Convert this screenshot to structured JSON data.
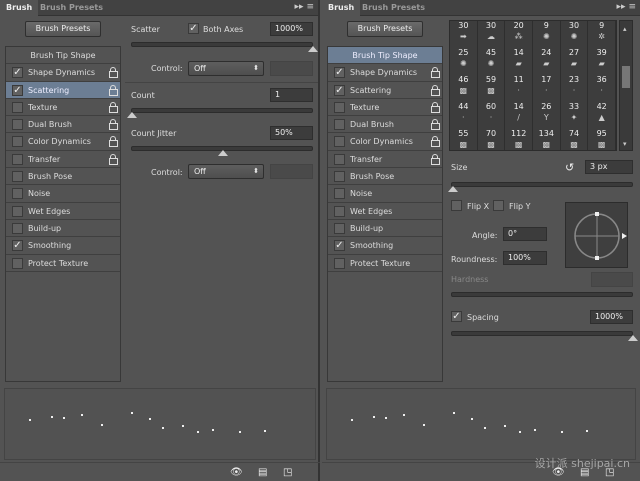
{
  "tabs": {
    "brush": "Brush",
    "presets": "Brush Presets",
    "collapse_icon": "▸▸",
    "menu_icon": "≡"
  },
  "preset_button": "Brush Presets",
  "list": {
    "head": "Brush Tip Shape",
    "items": [
      {
        "label": "Shape Dynamics",
        "checked": true
      },
      {
        "label": "Scattering",
        "checked": true
      },
      {
        "label": "Texture",
        "checked": false
      },
      {
        "label": "Dual Brush",
        "checked": false
      },
      {
        "label": "Color Dynamics",
        "checked": false
      },
      {
        "label": "Transfer",
        "checked": false
      },
      {
        "label": "Brush Pose",
        "checked": false
      },
      {
        "label": "Noise",
        "checked": false
      },
      {
        "label": "Wet Edges",
        "checked": false
      },
      {
        "label": "Build-up",
        "checked": false
      },
      {
        "label": "Smoothing",
        "checked": true
      },
      {
        "label": "Protect Texture",
        "checked": false
      }
    ]
  },
  "scattering": {
    "scatter_label": "Scatter",
    "both_axes_label": "Both Axes",
    "scatter_value": "1000%",
    "scatter_fraction": 1.0,
    "control_label": "Control:",
    "control_value": "Off",
    "count_label": "Count",
    "count_value": "1",
    "count_fraction": 0.0,
    "count_jitter_label": "Count Jitter",
    "count_jitter_value": "50%",
    "count_jitter_fraction": 0.5,
    "control2_label": "Control:",
    "control2_value": "Off"
  },
  "tip_shape": {
    "brush_sizes": [
      "30",
      "30",
      "20",
      "9",
      "30",
      "9",
      "25",
      "45",
      "14",
      "24",
      "27",
      "39",
      "46",
      "59",
      "11",
      "17",
      "23",
      "36",
      "44",
      "60",
      "14",
      "26",
      "33",
      "42",
      "55",
      "70",
      "112",
      "134",
      "74",
      "95"
    ],
    "size_label": "Size",
    "size_value": "3 px",
    "size_fraction": 0.01,
    "flip_x": "Flip X",
    "flip_y": "Flip Y",
    "angle_label": "Angle:",
    "angle_value": "0°",
    "roundness_label": "Roundness:",
    "roundness_value": "100%",
    "hardness_label": "Hardness",
    "spacing_label": "Spacing",
    "spacing_value": "1000%",
    "spacing_fraction": 1.0
  },
  "watermark": "设计派 shejipai.cn"
}
